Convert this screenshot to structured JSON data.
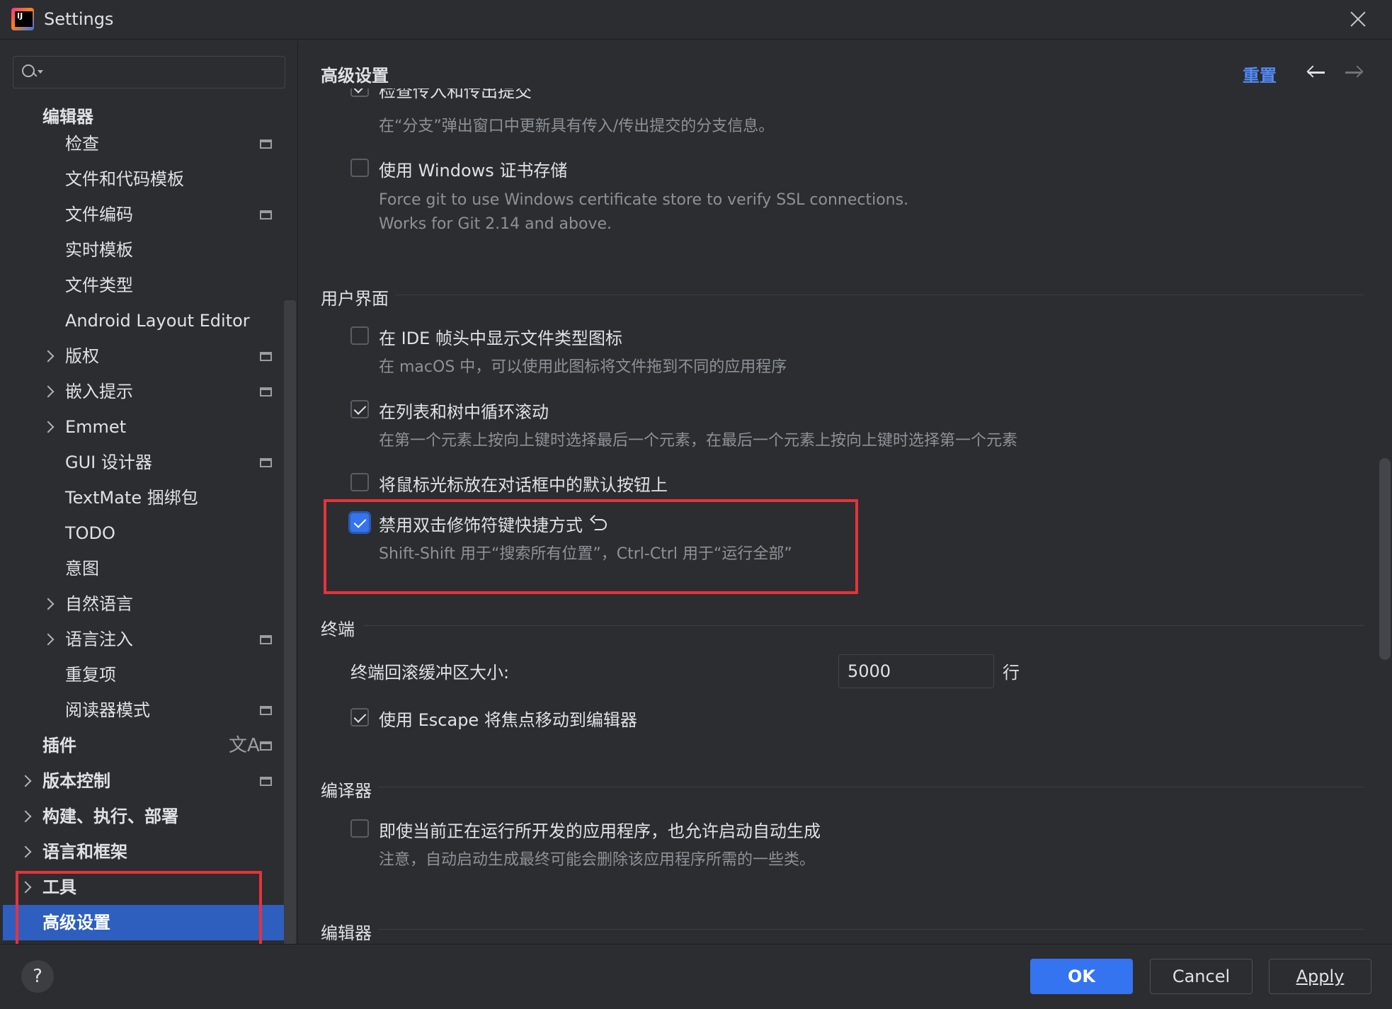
{
  "window": {
    "title": "Settings"
  },
  "search": {
    "placeholder": "",
    "value": ""
  },
  "sidebar": {
    "items": [
      {
        "label": "编辑器"
      },
      {
        "label": "检查"
      },
      {
        "label": "文件和代码模板"
      },
      {
        "label": "文件编码"
      },
      {
        "label": "实时模板"
      },
      {
        "label": "文件类型"
      },
      {
        "label": "Android Layout Editor"
      },
      {
        "label": "版权"
      },
      {
        "label": "嵌入提示"
      },
      {
        "label": "Emmet"
      },
      {
        "label": "GUI 设计器"
      },
      {
        "label": "TextMate 捆绑包"
      },
      {
        "label": "TODO"
      },
      {
        "label": "意图"
      },
      {
        "label": "自然语言"
      },
      {
        "label": "语言注入"
      },
      {
        "label": "重复项"
      },
      {
        "label": "阅读器模式"
      },
      {
        "label": "插件"
      },
      {
        "label": "版本控制"
      },
      {
        "label": "构建、执行、部署"
      },
      {
        "label": "语言和框架"
      },
      {
        "label": "工具"
      },
      {
        "label": "高级设置"
      }
    ]
  },
  "content": {
    "title": "高级设置",
    "reset": "重置",
    "options": {
      "incoming_outgoing": {
        "label": "检查传入和传出提交",
        "desc": "在“分支”弹出窗口中更新具有传入/传出提交的分支信息。"
      },
      "windows_cert": {
        "label": "使用 Windows 证书存储",
        "desc1": "Force git to use Windows certificate store to verify SSL connections.",
        "desc2": "Works for Git 2.14 and above."
      },
      "file_type_icon": {
        "label": "在 IDE 帧头中显示文件类型图标",
        "desc": "在 macOS 中，可以使用此图标将文件拖到不同的应用程序"
      },
      "cyclic_scroll": {
        "label": "在列表和树中循环滚动",
        "desc": "在第一个元素上按向上键时选择最后一个元素，在最后一个元素上按向上键时选择第一个元素"
      },
      "mouse_default_button": {
        "label": "将鼠标光标放在对话框中的默认按钮上"
      },
      "disable_double_modifier": {
        "label": "禁用双击修饰符键快捷方式",
        "desc": "Shift-Shift 用于“搜索所有位置”，Ctrl-Ctrl 用于“运行全部”"
      },
      "terminal_buffer": {
        "label": "终端回滚缓冲区大小:",
        "value": "5000",
        "unit": "行"
      },
      "escape_focus": {
        "label": "使用 Escape 将焦点移动到编辑器"
      },
      "auto_build": {
        "label": "即使当前正在运行所开发的应用程序，也允许启动自动生成",
        "desc": "注意，自动启动生成最终可能会删除该应用程序所需的一些类。"
      }
    },
    "sections": {
      "ui": "用户界面",
      "terminal": "终端",
      "compiler": "编译器",
      "editor": "编辑器"
    }
  },
  "footer": {
    "help": "?",
    "ok": "OK",
    "cancel": "Cancel",
    "apply": "Apply"
  },
  "colors": {
    "background": "#2b2d30",
    "accent": "#3574f0",
    "selection": "#2e5fbf",
    "link": "#548af7",
    "annotation": "#e5333a"
  }
}
